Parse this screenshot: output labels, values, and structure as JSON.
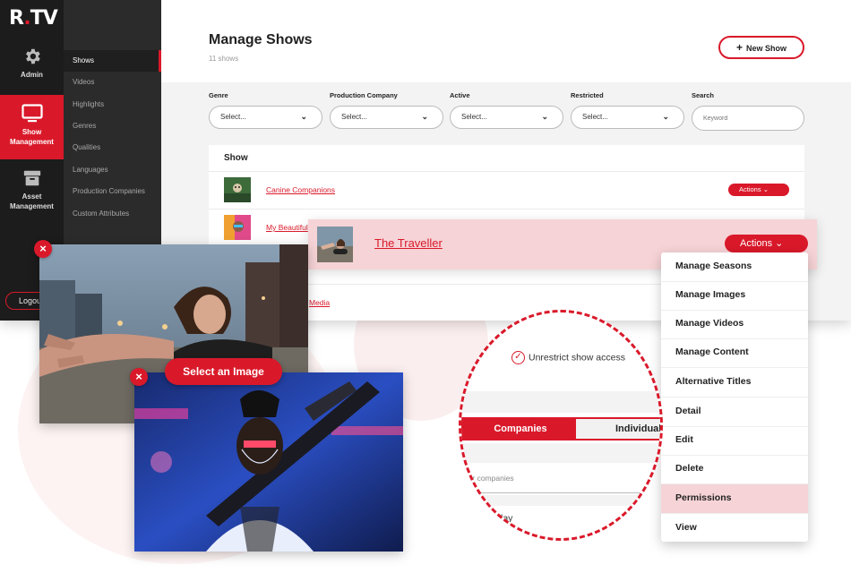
{
  "brand": {
    "logo_text": "R",
    "logo_dot": ".",
    "logo_rest": "TV",
    "accent": "#d9192a"
  },
  "rail": [
    {
      "label": "Admin",
      "icon": "gear-icon"
    },
    {
      "label": "Show Management",
      "icon": "tv-icon",
      "active": true
    },
    {
      "label": "Asset Management",
      "icon": "archive-icon"
    }
  ],
  "logout_label": "Logout",
  "subnav": [
    "Shows",
    "Videos",
    "Highlights",
    "Genres",
    "Qualities",
    "Languages",
    "Production Companies",
    "Custom Attributes"
  ],
  "header": {
    "title": "Manage Shows",
    "count": "11 shows",
    "new_show_label": "New Show"
  },
  "filters": {
    "genre": {
      "label": "Genre",
      "value": "Select..."
    },
    "production_company": {
      "label": "Production Company",
      "value": "Select..."
    },
    "active": {
      "label": "Active",
      "value": "Select..."
    },
    "restricted": {
      "label": "Restricted",
      "value": "Select..."
    },
    "search": {
      "label": "Search",
      "placeholder": "Keyword"
    }
  },
  "table": {
    "header": "Show",
    "rows": [
      {
        "title": "Canine Companions",
        "actions": "Actions"
      },
      {
        "title": "My Beautiful",
        "actions": "Actions"
      },
      {
        "title": "Media",
        "actions": "Actions"
      }
    ]
  },
  "highlight": {
    "title": "The Traveller",
    "actions": "Actions"
  },
  "actions_menu": [
    "Manage Seasons",
    "Manage Images",
    "Manage Videos",
    "Manage Content",
    "Alternative Titles",
    "Detail",
    "Edit",
    "Delete",
    "Permissions",
    "View"
  ],
  "actions_menu_active": "Permissions",
  "image_picker": {
    "button_label": "Select an Image"
  },
  "permissions": {
    "unrestrict_label": "Unrestrict show access",
    "tab_companies": "Companies",
    "tab_individuals": "Individuals",
    "search_placeholder": "Search for companies",
    "display_label": "Display"
  }
}
